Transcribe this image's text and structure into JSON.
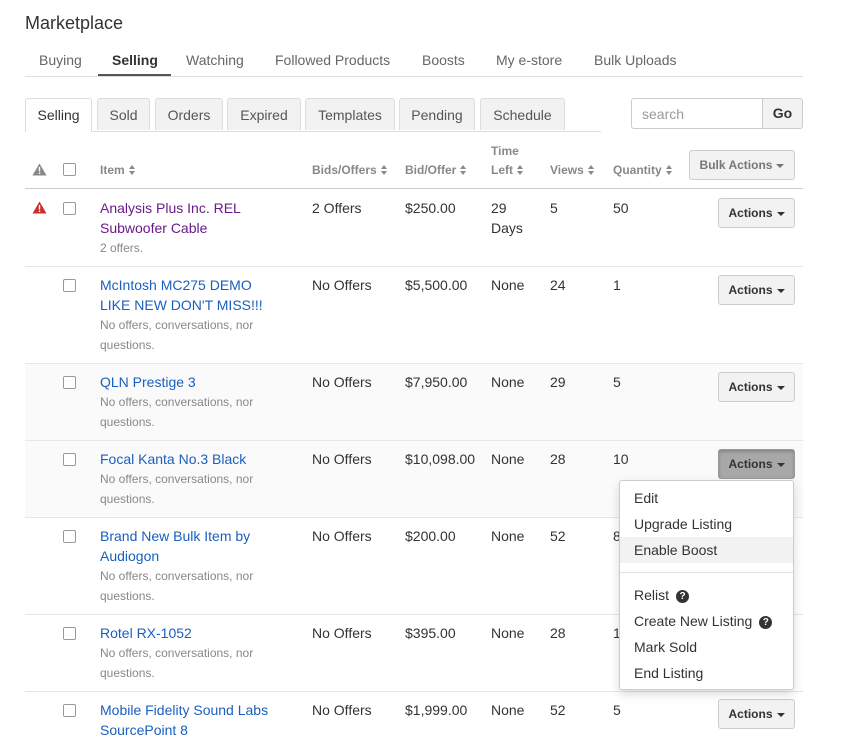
{
  "page": {
    "title": "Marketplace"
  },
  "nav": {
    "tabs": [
      {
        "label": "Buying"
      },
      {
        "label": "Selling"
      },
      {
        "label": "Watching"
      },
      {
        "label": "Followed Products"
      },
      {
        "label": "Boosts"
      },
      {
        "label": "My e-store"
      },
      {
        "label": "Bulk Uploads"
      }
    ],
    "active": "Selling"
  },
  "subtabs": [
    {
      "label": "Selling"
    },
    {
      "label": "Sold"
    },
    {
      "label": "Orders"
    },
    {
      "label": "Expired"
    },
    {
      "label": "Templates"
    },
    {
      "label": "Pending"
    },
    {
      "label": "Schedule"
    }
  ],
  "search": {
    "placeholder": "search",
    "value": "",
    "go_label": "Go"
  },
  "table": {
    "headers": {
      "item": "Item",
      "bids": "Bids/Offers",
      "bid_offer": "Bid/Offer",
      "time_left_1": "Time",
      "time_left_2": "Left",
      "views": "Views",
      "quantity": "Quantity"
    },
    "bulk_actions_label": "Bulk Actions",
    "actions_label": "Actions",
    "rows": [
      {
        "title1": "Analysis Plus Inc. REL",
        "title2": "Subwoofer Cable",
        "note1": "2 offers.",
        "note2": "",
        "bids": "2 Offers",
        "bid": "$250.00",
        "time1": "29",
        "time2": "Days",
        "views": "5",
        "qty": "50",
        "warning": true
      },
      {
        "title1": "McIntosh MC275 DEMO",
        "title2": "LIKE NEW DON'T MISS!!!",
        "note1": "No offers, conversations, nor",
        "note2": "questions.",
        "bids": "No Offers",
        "bid": "$5,500.00",
        "time1": "None",
        "time2": "",
        "views": "24",
        "qty": "1"
      },
      {
        "title1": "QLN Prestige 3",
        "title2": "",
        "note1": "No offers, conversations, nor",
        "note2": "questions.",
        "bids": "No Offers",
        "bid": "$7,950.00",
        "time1": "None",
        "time2": "",
        "views": "29",
        "qty": "5"
      },
      {
        "title1": "Focal Kanta No.3 Black",
        "title2": "",
        "note1": "No offers, conversations, nor",
        "note2": "questions.",
        "bids": "No Offers",
        "bid": "$10,098.00",
        "time1": "None",
        "time2": "",
        "views": "28",
        "qty": "10"
      },
      {
        "title1": "Brand New Bulk Item by",
        "title2": "Audiogon",
        "note1": "No offers, conversations, nor",
        "note2": "questions.",
        "bids": "No Offers",
        "bid": "$200.00",
        "time1": "None",
        "time2": "",
        "views": "52",
        "qty": "8"
      },
      {
        "title1": "Rotel RX-1052",
        "title2": "",
        "note1": "No offers, conversations, nor",
        "note2": "questions.",
        "bids": "No Offers",
        "bid": "$395.00",
        "time1": "None",
        "time2": "",
        "views": "28",
        "qty": "1"
      },
      {
        "title1": "Mobile Fidelity Sound Labs",
        "title2": "SourcePoint 8",
        "note1": "",
        "note2": "",
        "bids": "No Offers",
        "bid": "$1,999.00",
        "time1": "None",
        "time2": "",
        "views": "52",
        "qty": "5"
      }
    ]
  },
  "actions_menu": {
    "items": [
      {
        "label": "Edit"
      },
      {
        "label": "Upgrade Listing"
      },
      {
        "label": "Enable Boost"
      },
      {
        "label": "Relist"
      },
      {
        "label": "Create New Listing"
      },
      {
        "label": "Mark Sold"
      },
      {
        "label": "End Listing"
      }
    ],
    "help_glyph": "?"
  }
}
